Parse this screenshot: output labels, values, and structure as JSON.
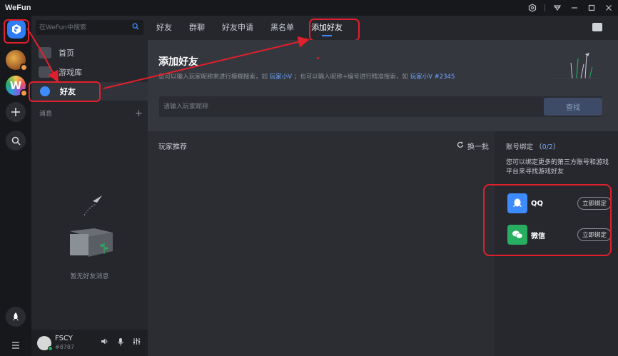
{
  "window": {
    "title": "WeFun",
    "controls": [
      "settings-icon",
      "user-icon",
      "minimize",
      "maximize",
      "close"
    ]
  },
  "rail": {
    "items": [
      "wefun-logo",
      "game-avatar",
      "w-avatar",
      "plus",
      "search",
      "rocket",
      "menu"
    ],
    "w_avatar_letter": "W"
  },
  "nav": {
    "search_placeholder": "在WeFun中搜索",
    "items": [
      {
        "label": "首页",
        "icon": "home-icon"
      },
      {
        "label": "游戏库",
        "icon": "gamepad-icon"
      },
      {
        "label": "好友",
        "icon": "friends-icon",
        "selected": true
      }
    ],
    "messages_label": "消息",
    "empty_text": "暂无好友消息"
  },
  "user": {
    "name": "FSCY",
    "id": "#8787",
    "status": "online"
  },
  "tabs": [
    {
      "label": "好友"
    },
    {
      "label": "群聊"
    },
    {
      "label": "好友申请"
    },
    {
      "label": "黑名单"
    },
    {
      "label": "添加好友",
      "active": true
    }
  ],
  "add_friend": {
    "title": "添加好友",
    "desc_part1": "您可以输入玩家昵称来进行模糊搜索，如",
    "desc_example1": "玩家小V",
    "desc_part2": "；也可以输入昵称+编号进行精准搜索，如",
    "desc_example2": "玩家小V #2345",
    "input_placeholder": "请输入玩家昵称",
    "find_label": "查找"
  },
  "recommend": {
    "title": "玩家推荐",
    "refresh_label": "换一批"
  },
  "binding": {
    "title": "账号绑定",
    "count": "0/2",
    "desc": "您可以绑定更多的第三方账号和游戏平台来寻找游戏好友",
    "accounts": [
      {
        "name": "QQ",
        "button": "立即绑定",
        "color": "#3d8bfd"
      },
      {
        "name": "微信",
        "button": "立即绑定",
        "color": "#27ae60"
      }
    ]
  },
  "colors": {
    "accent": "#3d8bfd",
    "annotation": "#e0202c"
  }
}
